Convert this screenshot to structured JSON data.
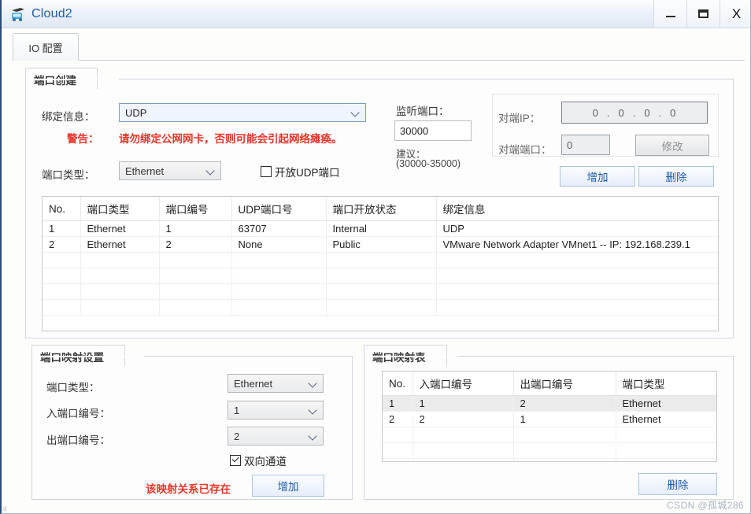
{
  "window": {
    "title": "Cloud2",
    "icon": "cloud-device-icon",
    "controls": {
      "minimize": "minimize-icon",
      "maximize": "maximize-icon",
      "close": "X"
    }
  },
  "tabs": [
    {
      "label": "IO 配置",
      "active": true
    }
  ],
  "port_create": {
    "caption": "端口创建",
    "binding_label": "绑定信息：",
    "binding_value": "UDP",
    "binding_options": [
      "UDP",
      "VMware Network Adapter VMnet1 -- IP: 192.168.239.1"
    ],
    "warning_label": "警告：",
    "warning_text": "请勿绑定公网网卡，否则可能会引起网络瘫痪。",
    "port_type_label": "端口类型：",
    "port_type_value": "Ethernet",
    "port_type_options": [
      "Ethernet"
    ],
    "open_udp_label": "开放UDP端口",
    "open_udp_checked": false,
    "listen_port_label": "监听端口：",
    "listen_port_value": "30000",
    "suggest_label": "建议：",
    "suggest_range": "(30000-35000)",
    "peer_ip_label": "对端IP：",
    "peer_ip_octets": [
      "0",
      "0",
      "0",
      "0"
    ],
    "peer_port_label": "对端端口：",
    "peer_port_value": "0",
    "modify_label": "修改",
    "modify_disabled": true,
    "add_label": "增加",
    "delete_label": "删除"
  },
  "port_table": {
    "headers": [
      "No.",
      "端口类型",
      "端口编号",
      "UDP端口号",
      "端口开放状态",
      "绑定信息"
    ],
    "rows": [
      [
        "1",
        "Ethernet",
        "1",
        "63707",
        "Internal",
        "UDP"
      ],
      [
        "2",
        "Ethernet",
        "2",
        "None",
        "Public",
        "VMware Network Adapter VMnet1 -- IP: 192.168.239.1"
      ]
    ],
    "empty_rows": 4
  },
  "mapping_settings": {
    "caption": "端口映射设置",
    "port_type_label": "端口类型：",
    "port_type_value": "Ethernet",
    "in_port_label": "入端口编号：",
    "in_port_value": "1",
    "out_port_label": "出端口编号：",
    "out_port_value": "2",
    "bidirectional_label": "双向通道",
    "bidirectional_checked": true,
    "error_text": "该映射关系已存在",
    "add_label": "增加"
  },
  "mapping_table": {
    "caption": "端口映射表",
    "headers": [
      "No.",
      "入端口编号",
      "出端口编号",
      "端口类型"
    ],
    "rows": [
      [
        "1",
        "1",
        "2",
        "Ethernet"
      ],
      [
        "2",
        "2",
        "1",
        "Ethernet"
      ]
    ],
    "empty_rows": 3,
    "delete_label": "删除"
  },
  "watermark": "CSDN @孤城286",
  "colors": {
    "title_text": "#1f5ba8",
    "warning": "#e8352a",
    "button_text": "#1f5ba8",
    "selection": "#ebebeb"
  }
}
